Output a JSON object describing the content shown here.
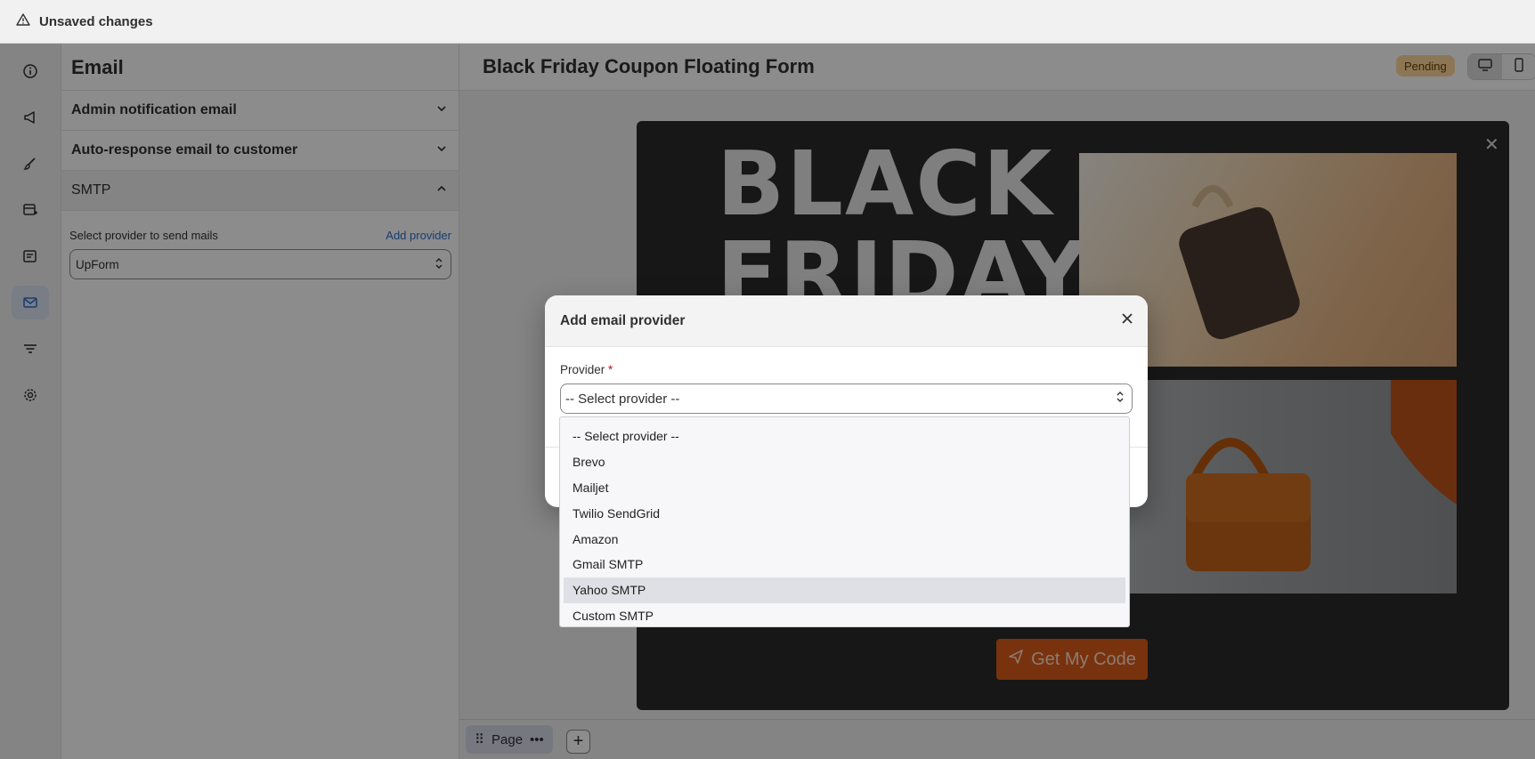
{
  "topbar": {
    "title": "Unsaved changes",
    "icon": "warning-triangle-icon"
  },
  "rail": {
    "items": [
      "info-icon",
      "megaphone-icon",
      "brush-icon",
      "form-layout-icon",
      "list-editor-icon",
      "email-icon",
      "filter-icon",
      "settings-icon"
    ],
    "active": "email-icon"
  },
  "sidebar": {
    "title": "Email",
    "sections": [
      {
        "label": "Admin notification email"
      },
      {
        "label": "Auto-response email to customer"
      },
      {
        "label": "SMTP"
      }
    ],
    "smtp": {
      "select_label": "Select provider to send mails",
      "add_provider": "Add provider",
      "selected": "UpForm"
    }
  },
  "main": {
    "title": "Black Friday Coupon Floating Form",
    "status": "Pending",
    "canvas": {
      "heading_line1": "BLACK",
      "heading_line2": "FRIDAY",
      "cta": "Get My Code"
    },
    "bottom": {
      "page_label": "Page",
      "add": "+"
    }
  },
  "modal": {
    "title": "Add email provider",
    "field_label": "Provider",
    "required_mark": "*",
    "select_value": "-- Select provider --"
  },
  "dropdown": {
    "options": [
      "-- Select provider --",
      "Brevo",
      "Mailjet",
      "Twilio SendGrid",
      "Amazon",
      "Gmail SMTP",
      "Yahoo SMTP",
      "Custom SMTP"
    ],
    "highlighted": "Yahoo SMTP"
  },
  "colors": {
    "accent": "#2c6ecb",
    "cta": "#dc5b1a",
    "pending_bg": "#ffd79d"
  }
}
